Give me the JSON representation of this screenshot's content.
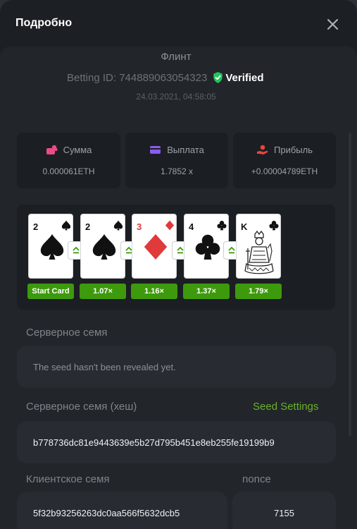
{
  "header": {
    "title": "Подробно",
    "close_icon": "close-icon"
  },
  "bet": {
    "game": "Флинт",
    "betting_label": "Betting ID: 744889063054323",
    "verified_label": "Verified",
    "date": "24.03.2021, 04:58:05"
  },
  "stats": {
    "amount": {
      "label": "Сумма",
      "value": "0.000061ETH",
      "icon": "wallet-coins-icon",
      "color": "#e94b84"
    },
    "payout": {
      "label": "Выплата",
      "value": "1.7852 x",
      "icon": "card-icon",
      "color": "#8a5bf2"
    },
    "profit": {
      "label": "Прибыль",
      "value": "+0.00004789ETH",
      "icon": "hand-coin-icon",
      "color": "#e8453c"
    }
  },
  "cards": [
    {
      "rank": "2",
      "suit": "spades",
      "multiplier": "Start Card"
    },
    {
      "rank": "2",
      "suit": "spades",
      "multiplier": "1.07×"
    },
    {
      "rank": "3",
      "suit": "diamonds",
      "multiplier": "1.16×"
    },
    {
      "rank": "4",
      "suit": "clubs",
      "multiplier": "1.37×"
    },
    {
      "rank": "K",
      "suit": "clubs",
      "multiplier": "1.79×"
    }
  ],
  "server_seed": {
    "label": "Серверное семя",
    "value": "The seed hasn't been revealed yet."
  },
  "server_seed_hash": {
    "label": "Серверное семя (хеш)",
    "link": "Seed Settings",
    "value": "b778736dc81e9443639e5b27d795b451e8eb255fe19199b9"
  },
  "client_seed": {
    "label": "Клиентское семя",
    "value": "5f32b93256263dc0aa566f5632dcb5"
  },
  "nonce": {
    "label": "nonce",
    "value": "7155"
  },
  "colors": {
    "accent_green": "#3d9a0c",
    "link_green": "#6ab02c",
    "verified_green": "#26c25a"
  }
}
